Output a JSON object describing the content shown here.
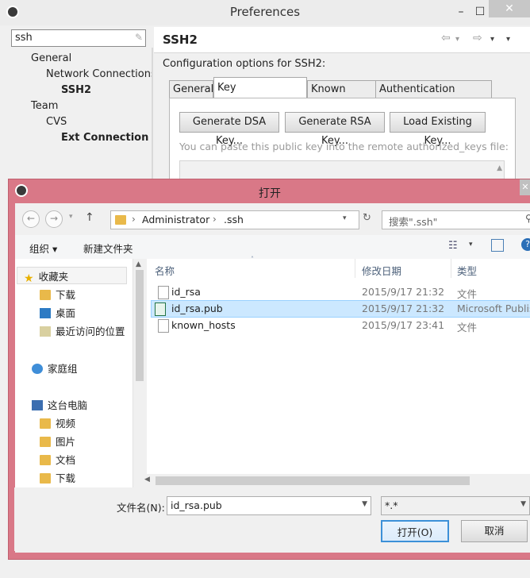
{
  "preferences": {
    "title": "Preferences",
    "filter_value": "ssh",
    "tree": [
      {
        "label": "General",
        "level": 1,
        "bold": false
      },
      {
        "label": "Network Connections",
        "level": 2,
        "bold": false
      },
      {
        "label": "SSH2",
        "level": 3,
        "bold": true
      },
      {
        "label": "Team",
        "level": 1,
        "bold": false
      },
      {
        "label": "CVS",
        "level": 2,
        "bold": false
      },
      {
        "label": "Ext Connection Method",
        "level": 3,
        "bold": true
      }
    ],
    "page_title": "SSH2",
    "config_text": "Configuration options for SSH2:",
    "tabs": [
      "General",
      "Key Management",
      "Known Hosts",
      "Authentication Methods"
    ],
    "active_tab": "Key Management",
    "buttons": {
      "generate_dsa": "Generate DSA Key...",
      "generate_rsa": "Generate RSA Key...",
      "load_existing": "Load Existing Key..."
    },
    "paste_hint": "You can paste this public key into the remote authorized_keys file:"
  },
  "dialog": {
    "title": "打开",
    "breadcrumb": [
      "Administrator",
      ".ssh"
    ],
    "search_placeholder": "搜索\".ssh\"",
    "organize_label": "组织 ▾",
    "new_folder_label": "新建文件夹",
    "nav": {
      "favorites": "收藏夹",
      "downloads": "下载",
      "desktop": "桌面",
      "recent": "最近访问的位置",
      "homegroup": "家庭组",
      "this_pc": "这台电脑",
      "videos": "视频",
      "pictures": "图片",
      "documents": "文档",
      "downloads2": "下载"
    },
    "columns": {
      "name": "名称",
      "date": "修改日期",
      "type": "类型"
    },
    "files": [
      {
        "name": "id_rsa",
        "date": "2015/9/17 21:32",
        "type": "文件",
        "selected": false
      },
      {
        "name": "id_rsa.pub",
        "date": "2015/9/17 21:32",
        "type": "Microsoft Publisher",
        "selected": true
      },
      {
        "name": "known_hosts",
        "date": "2015/9/17 23:41",
        "type": "文件",
        "selected": false
      }
    ],
    "filename_label": "文件名(N):",
    "filename_value": "id_rsa.pub",
    "filter_value": "*.*",
    "open_button": "打开(O)",
    "cancel_button": "取消"
  }
}
